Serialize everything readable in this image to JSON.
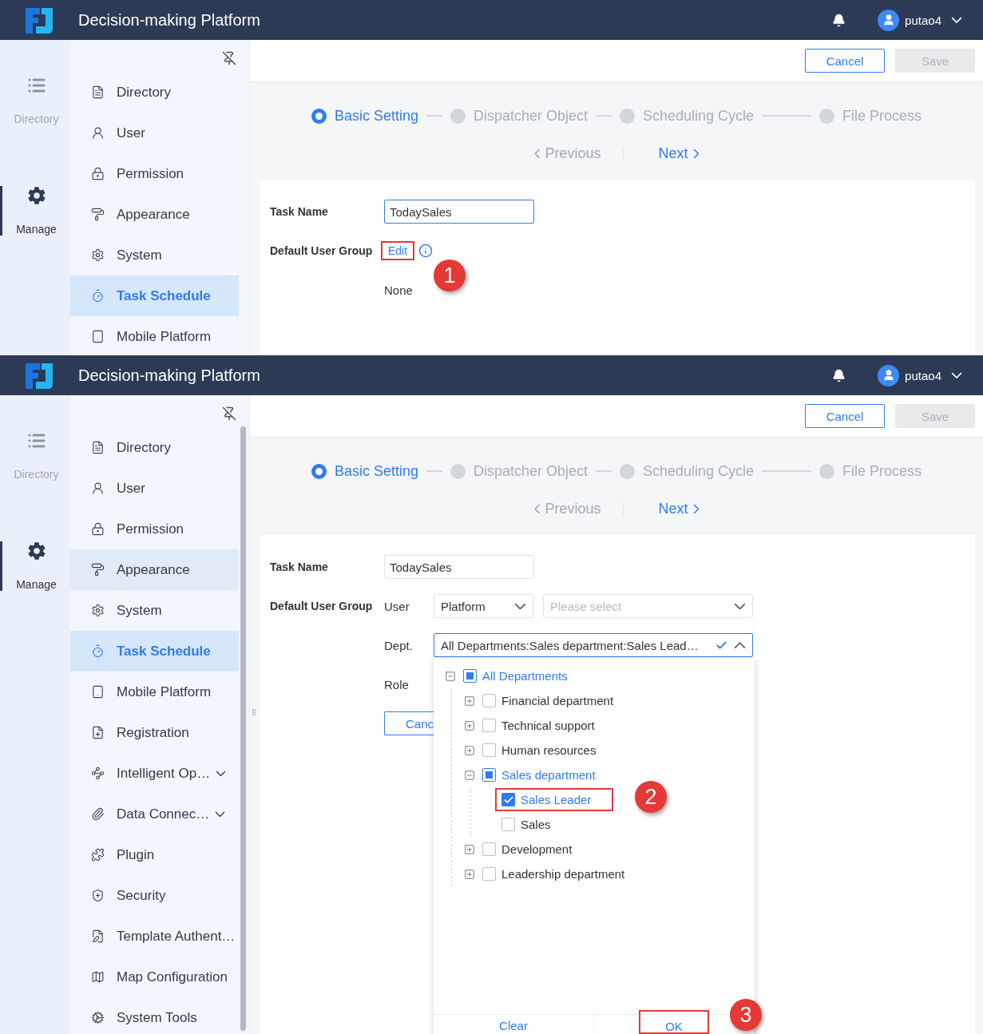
{
  "panels": [
    {
      "header": {
        "title": "Decision-making Platform",
        "user": "putao4"
      },
      "rail": [
        {
          "label": "Directory",
          "selected": false
        },
        {
          "label": "Manage",
          "selected": true
        }
      ],
      "nav": [
        {
          "label": "Directory",
          "selected": false,
          "hovered": false,
          "has_submenu": false
        },
        {
          "label": "User",
          "selected": false,
          "hovered": false,
          "has_submenu": false
        },
        {
          "label": "Permission",
          "selected": false,
          "hovered": false,
          "has_submenu": false
        },
        {
          "label": "Appearance",
          "selected": false,
          "hovered": false,
          "has_submenu": false
        },
        {
          "label": "System",
          "selected": false,
          "hovered": false,
          "has_submenu": false
        },
        {
          "label": "Task Schedule",
          "selected": true,
          "hovered": false,
          "has_submenu": false
        },
        {
          "label": "Mobile Platform",
          "selected": false,
          "hovered": false,
          "has_submenu": false
        }
      ],
      "toolbar": [
        {
          "label": "Cancel",
          "disabled": false
        },
        {
          "label": "Save",
          "disabled": true
        }
      ],
      "steps": [
        {
          "label": "Basic Setting",
          "selected": true
        },
        {
          "label": "Dispatcher Object",
          "selected": false
        },
        {
          "label": "Scheduling Cycle",
          "selected": false
        },
        {
          "label": "File Process",
          "selected": false
        }
      ],
      "pager": [
        {
          "label": "Previous",
          "disabled": true
        },
        {
          "label": "Next",
          "disabled": false
        }
      ],
      "form": {
        "kind": "summary",
        "task_label": "Task Name",
        "task_value": "TodaySales",
        "task_focused": true,
        "group_label": "Default User Group",
        "edit_link": {
          "label": "Edit",
          "highlighted": true
        },
        "value": "None",
        "marker": "1"
      }
    },
    {
      "header": {
        "title": "Decision-making Platform",
        "user": "putao4"
      },
      "rail": [
        {
          "label": "Directory",
          "selected": false
        },
        {
          "label": "Manage",
          "selected": true
        }
      ],
      "nav": [
        {
          "label": "Directory",
          "selected": false,
          "hovered": false,
          "has_submenu": false
        },
        {
          "label": "User",
          "selected": false,
          "hovered": false,
          "has_submenu": false
        },
        {
          "label": "Permission",
          "selected": false,
          "hovered": false,
          "has_submenu": false
        },
        {
          "label": "Appearance",
          "selected": false,
          "hovered": true,
          "has_submenu": false
        },
        {
          "label": "System",
          "selected": false,
          "hovered": false,
          "has_submenu": false
        },
        {
          "label": "Task Schedule",
          "selected": true,
          "hovered": false,
          "has_submenu": false
        },
        {
          "label": "Mobile Platform",
          "selected": false,
          "hovered": false,
          "has_submenu": false
        },
        {
          "label": "Registration",
          "selected": false,
          "hovered": false,
          "has_submenu": false
        },
        {
          "label": "Intelligent Op…",
          "selected": false,
          "hovered": false,
          "has_submenu": true
        },
        {
          "label": "Data Connec…",
          "selected": false,
          "hovered": false,
          "has_submenu": true
        },
        {
          "label": "Plugin",
          "selected": false,
          "hovered": false,
          "has_submenu": false
        },
        {
          "label": "Security",
          "selected": false,
          "hovered": false,
          "has_submenu": false
        },
        {
          "label": "Template Authent…",
          "selected": false,
          "hovered": false,
          "has_submenu": false
        },
        {
          "label": "Map Configuration",
          "selected": false,
          "hovered": false,
          "has_submenu": false
        },
        {
          "label": "System Tools",
          "selected": false,
          "hovered": false,
          "has_submenu": false
        }
      ],
      "toolbar": [
        {
          "label": "Cancel",
          "disabled": false
        },
        {
          "label": "Save",
          "disabled": true
        }
      ],
      "steps": [
        {
          "label": "Basic Setting",
          "selected": true
        },
        {
          "label": "Dispatcher Object",
          "selected": false
        },
        {
          "label": "Scheduling Cycle",
          "selected": false
        },
        {
          "label": "File Process",
          "selected": false
        }
      ],
      "pager": [
        {
          "label": "Previous",
          "disabled": true
        },
        {
          "label": "Next",
          "disabled": false
        }
      ],
      "form": {
        "kind": "editor",
        "task_label": "Task Name",
        "task_value": "TodaySales",
        "task_focused": false,
        "group_label": "Default User Group",
        "user_label": "User",
        "user_select": "Platform",
        "user_placeholder": "Please select",
        "dept_label": "Dept.",
        "dept_value": "All Departments:Sales department:Sales Lead…",
        "dept_open": true,
        "role_label": "Role",
        "cancel_label": "Canc",
        "tree": [
          {
            "label": "All Departments",
            "checked": false,
            "indeterminate": true,
            "expanded": true,
            "highlighted": false,
            "children": [
              {
                "label": "Financial department",
                "checked": false,
                "indeterminate": false,
                "expanded": false,
                "highlighted": false
              },
              {
                "label": "Technical support",
                "checked": false,
                "indeterminate": false,
                "expanded": false,
                "highlighted": false
              },
              {
                "label": "Human resources",
                "checked": false,
                "indeterminate": false,
                "expanded": false,
                "highlighted": false
              },
              {
                "label": "Sales department",
                "checked": false,
                "indeterminate": true,
                "expanded": true,
                "highlighted": false,
                "children": [
                  {
                    "label": "Sales Leader",
                    "checked": true,
                    "indeterminate": false,
                    "highlighted": true
                  },
                  {
                    "label": "Sales",
                    "checked": false,
                    "indeterminate": false,
                    "highlighted": false
                  }
                ]
              },
              {
                "label": "Development",
                "checked": false,
                "indeterminate": false,
                "expanded": false,
                "highlighted": false
              },
              {
                "label": "Leadership department",
                "checked": false,
                "indeterminate": false,
                "expanded": false,
                "highlighted": false
              }
            ]
          }
        ],
        "footer": [
          {
            "label": "Clear",
            "highlighted": false
          },
          {
            "label": "OK",
            "highlighted": true
          }
        ],
        "markers": [
          "2",
          "3"
        ]
      }
    }
  ]
}
